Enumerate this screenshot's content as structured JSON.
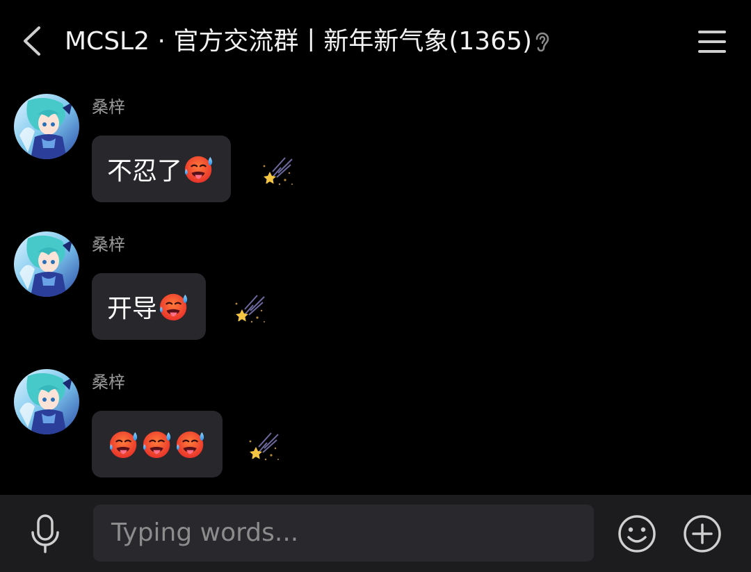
{
  "header": {
    "title": "MCSL2 · 官方交流群丨新年新气象(1365)"
  },
  "messages": [
    {
      "sender": "桑梓",
      "text": "不忍了",
      "emoji_count": 1,
      "emoji": "hot-face-icon"
    },
    {
      "sender": "桑梓",
      "text": "开导",
      "emoji_count": 1,
      "emoji": "hot-face-icon"
    },
    {
      "sender": "桑梓",
      "text": "",
      "emoji_count": 3,
      "emoji": "hot-face-icon"
    }
  ],
  "input": {
    "placeholder": "Typing words..."
  },
  "colors": {
    "background": "#000000",
    "bubble": "#28272c",
    "input_bar": "#1c1c1e",
    "icon": "#d0d0d0"
  }
}
